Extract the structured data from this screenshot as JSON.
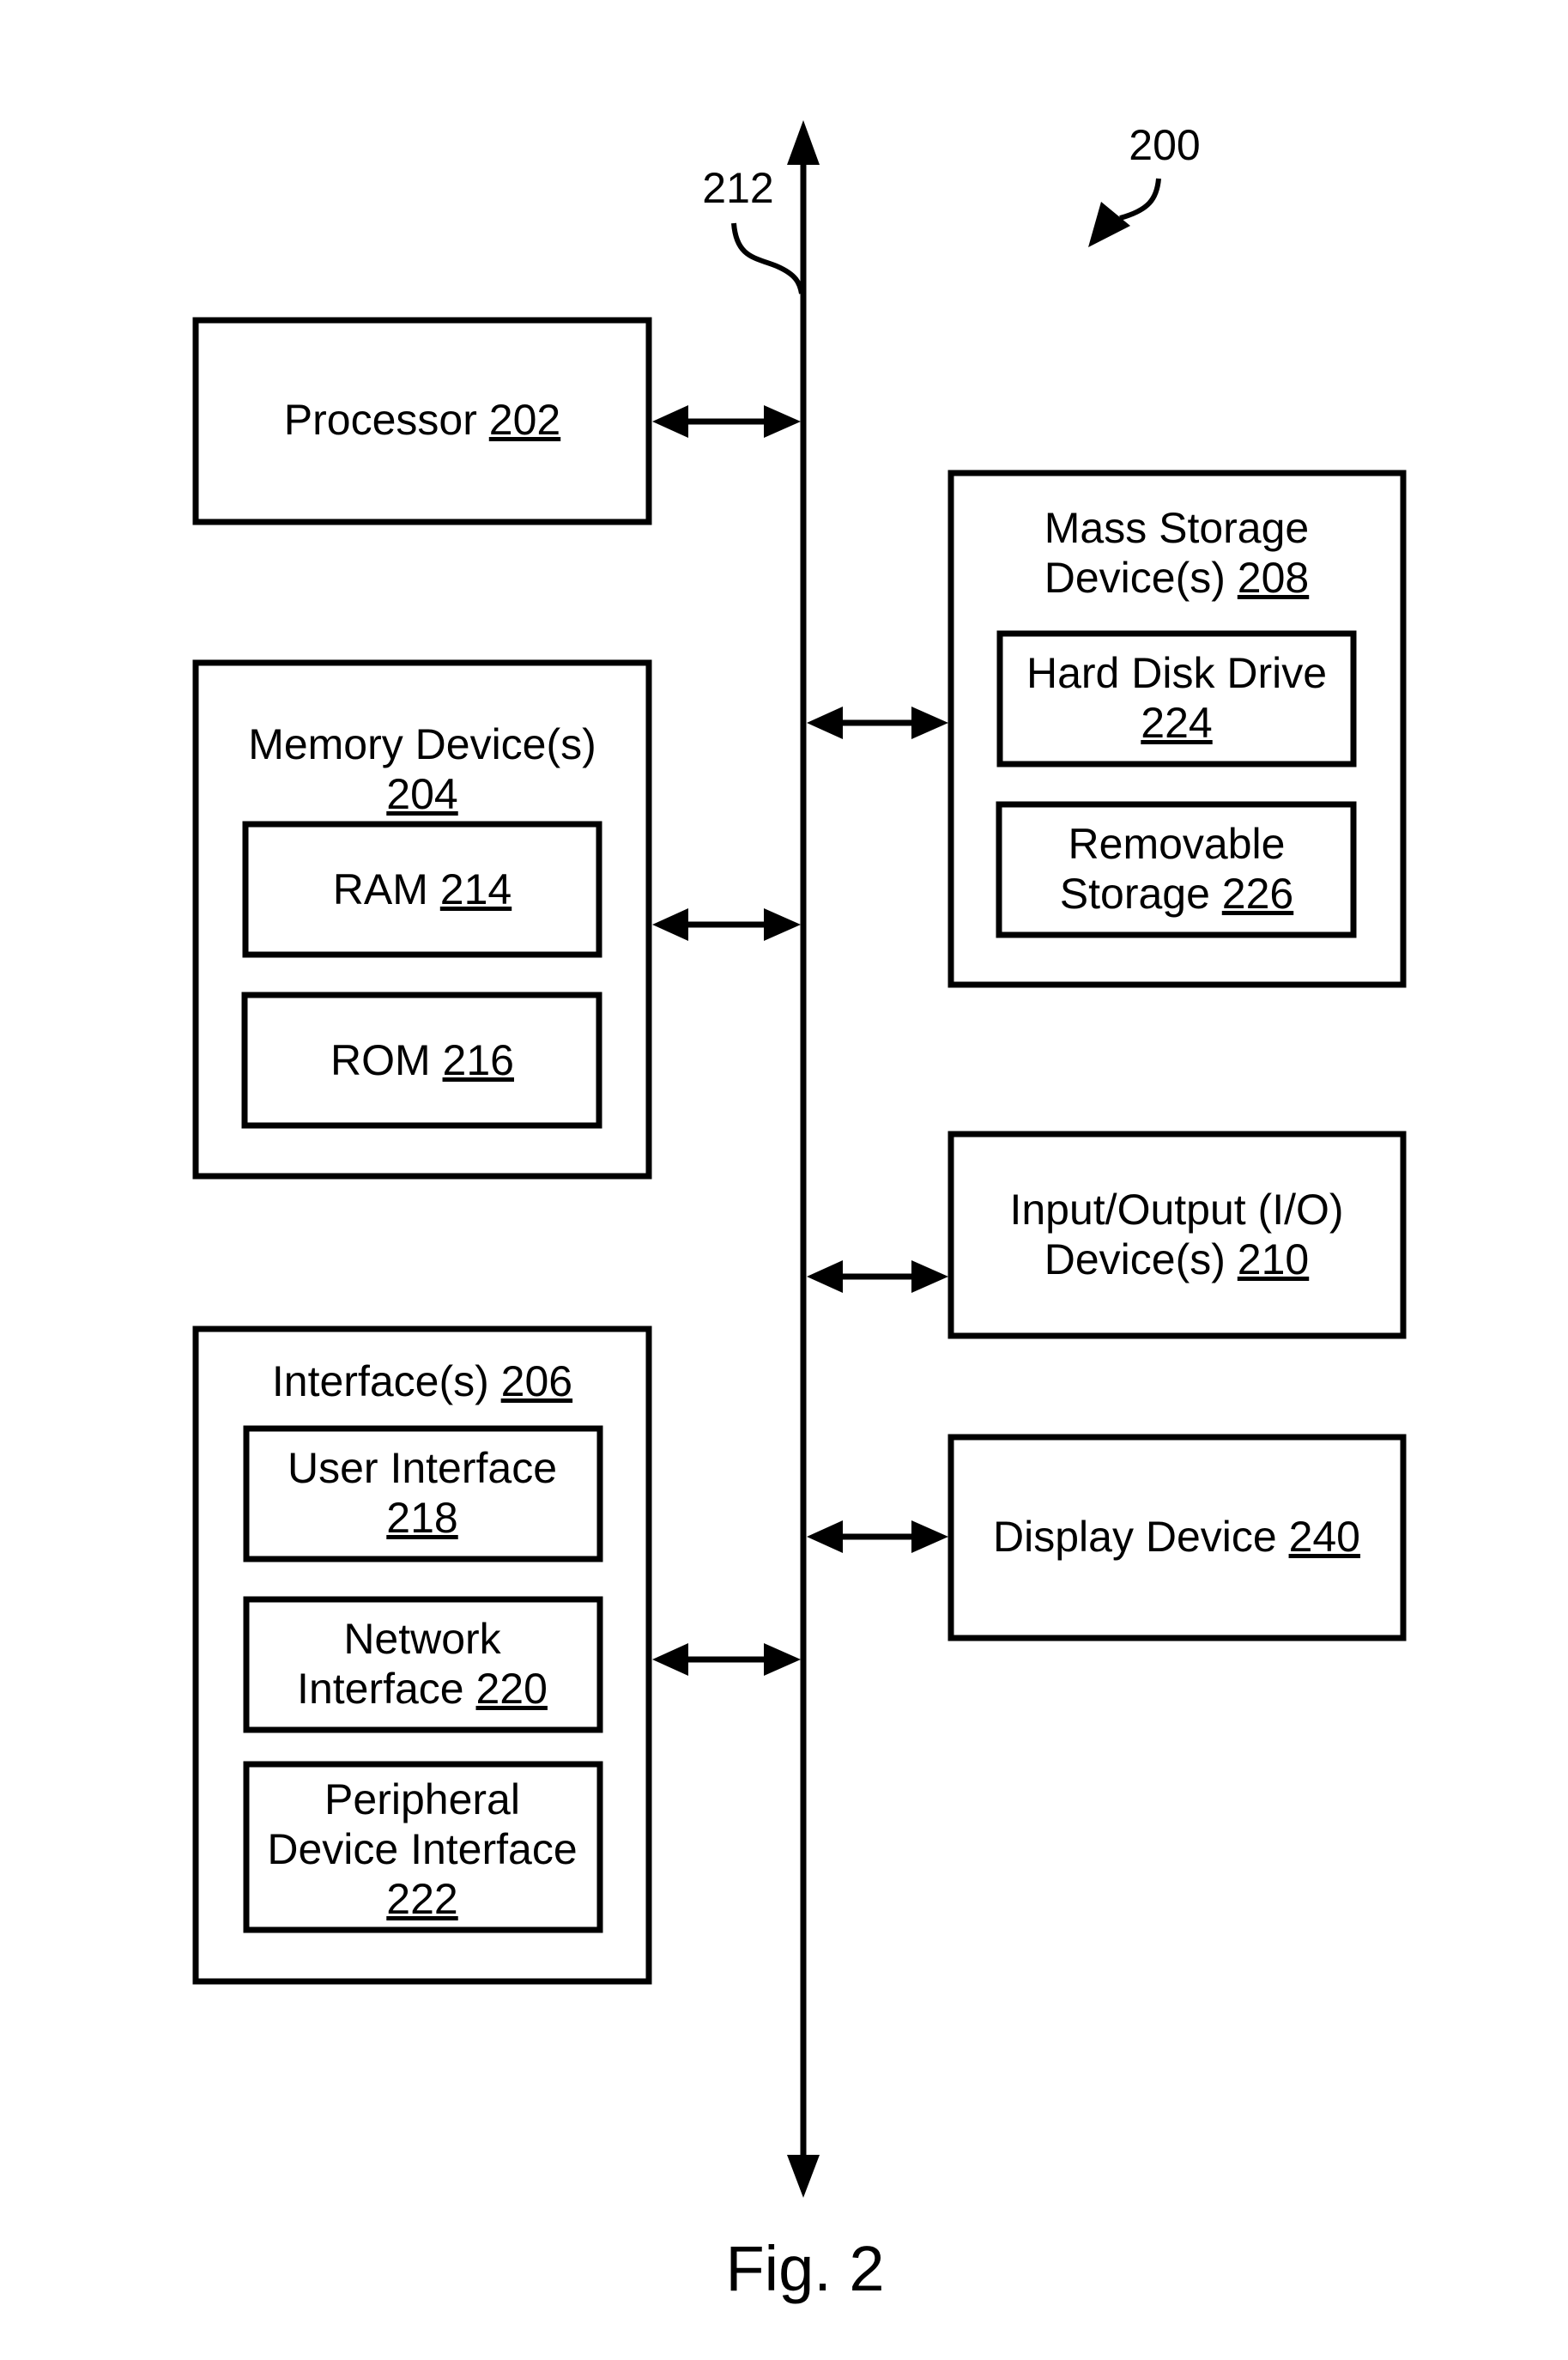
{
  "figure": {
    "reference_number": "200",
    "caption": "Fig. 2"
  },
  "bus": {
    "reference_number": "212"
  },
  "blocks": {
    "processor": {
      "text": "Processor ",
      "ref": "202"
    },
    "memory": {
      "line1": "Memory Device(s)",
      "ref": "204",
      "ram": {
        "text": "RAM ",
        "ref": "214"
      },
      "rom": {
        "text": "ROM ",
        "ref": "216"
      }
    },
    "interfaces": {
      "text": "Interface(s) ",
      "ref": "206",
      "user_interface": {
        "line1": "User Interface",
        "ref": "218"
      },
      "network_interface": {
        "line1": "Network",
        "line2": "Interface ",
        "ref": "220"
      },
      "peripheral_interface": {
        "line1": "Peripheral",
        "line2": "Device Interface",
        "ref": "222"
      }
    },
    "mass_storage": {
      "line1": "Mass Storage",
      "line2": "Device(s) ",
      "ref": "208",
      "hard_disk": {
        "line1": "Hard Disk Drive",
        "ref": "224"
      },
      "removable": {
        "line1": "Removable",
        "line2": "Storage ",
        "ref": "226"
      }
    },
    "io": {
      "line1": "Input/Output (I/O)",
      "line2": "Device(s) ",
      "ref": "210"
    },
    "display": {
      "text": "Display Device ",
      "ref": "240"
    }
  }
}
